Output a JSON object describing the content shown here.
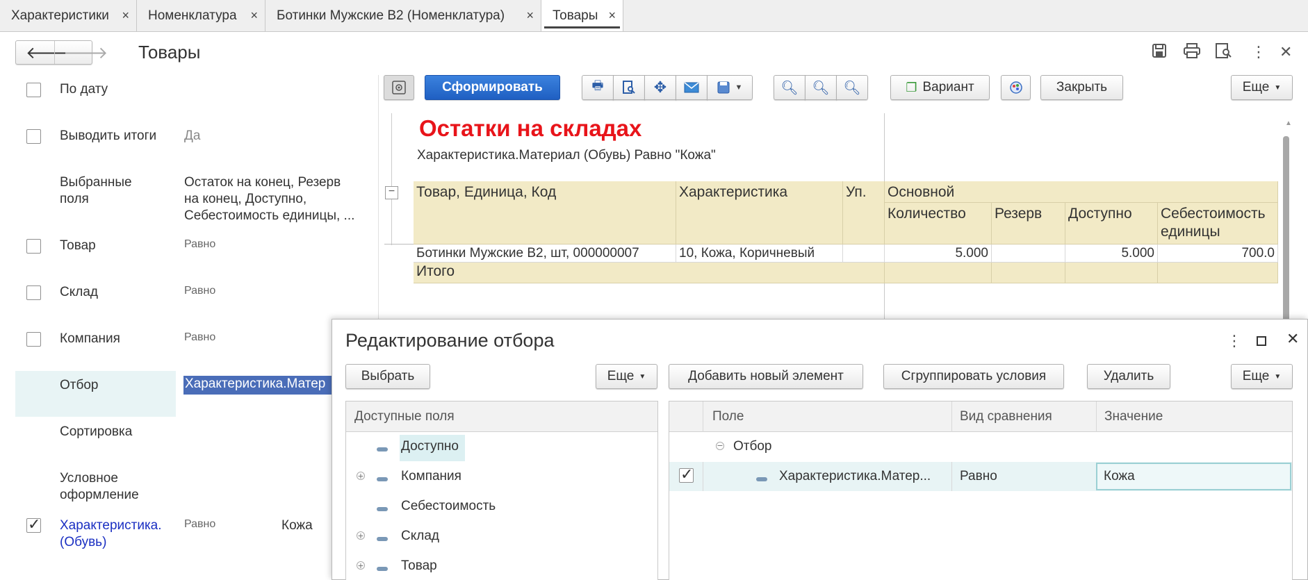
{
  "tabs": [
    {
      "label": "Характеристики",
      "close": "×"
    },
    {
      "label": "Номенклатура",
      "close": "×"
    },
    {
      "label": "Ботинки Мужские В2 (Номенклатура)",
      "close": "×"
    },
    {
      "label": "Товары",
      "close": "×"
    }
  ],
  "header": {
    "title": "Товары",
    "back_icon": "arrow-left",
    "forward_icon": "arrow-right"
  },
  "left_panel": {
    "rows": [
      {
        "label": "По дату",
        "value": "",
        "comparison": ""
      },
      {
        "label": "Выводить итоги",
        "value": "Да",
        "comparison": ""
      },
      {
        "label": "Выбранные\nполя",
        "value": "Остаток на конец, Резерв\nна конец, Доступно,\nСебестоимость единицы, ...",
        "comparison": ""
      },
      {
        "label": "Товар",
        "value": "",
        "comparison": "Равно"
      },
      {
        "label": "Склад",
        "value": "",
        "comparison": "Равно"
      },
      {
        "label": "Компания",
        "value": "",
        "comparison": "Равно"
      },
      {
        "label": "Отбор",
        "value": "Характеристика.Матер",
        "comparison": ""
      },
      {
        "label": "Сортировка",
        "value": "",
        "comparison": ""
      },
      {
        "label": "Условное\nоформление",
        "value": "",
        "comparison": ""
      },
      {
        "label": "Характеристика.\n(Обувь)",
        "value": "Кожа",
        "comparison": "Равно",
        "checked": true
      }
    ]
  },
  "toolbar": {
    "generate": "Сформировать",
    "variant": "Вариант",
    "close": "Закрыть",
    "more": "Еще"
  },
  "report": {
    "title": "Остатки на складах",
    "filter_text": "Характеристика.Материал (Обувь) Равно \"Кожа\"",
    "headers": {
      "goods": "Товар, Единица, Код",
      "characteristic": "Характеристика",
      "pack": "Уп.",
      "group_main": "Основной",
      "qty": "Количество",
      "reserve": "Резерв",
      "available": "Доступно",
      "cost": "Себестоимость\nединицы"
    },
    "rows": [
      {
        "goods": "Ботинки Мужские В2, шт, 000000007",
        "characteristic": "10, Кожа, Коричневый",
        "pack": "",
        "qty": "5.000",
        "reserve": "",
        "available": "5.000",
        "cost": "700.0"
      }
    ],
    "total_label": "Итого"
  },
  "dialog": {
    "title": "Редактирование отбора",
    "select_btn": "Выбрать",
    "more_left": "Еще",
    "add_btn": "Добавить новый элемент",
    "group_btn": "Сгруппировать условия",
    "delete_btn": "Удалить",
    "more_right": "Еще",
    "available_fields_header": "Доступные поля",
    "fields": [
      {
        "label": "Доступно",
        "expandable": false
      },
      {
        "label": "Компания",
        "expandable": true
      },
      {
        "label": "Себестоимость",
        "expandable": false
      },
      {
        "label": "Склад",
        "expandable": true
      },
      {
        "label": "Товар",
        "expandable": true
      }
    ],
    "filter_columns": {
      "field": "Поле",
      "comparison": "Вид сравнения",
      "value": "Значение"
    },
    "filter_root": "Отбор",
    "filter_rows": [
      {
        "field": "Характеристика.Матер...",
        "comparison": "Равно",
        "value": "Кожа",
        "checked": true
      }
    ]
  }
}
